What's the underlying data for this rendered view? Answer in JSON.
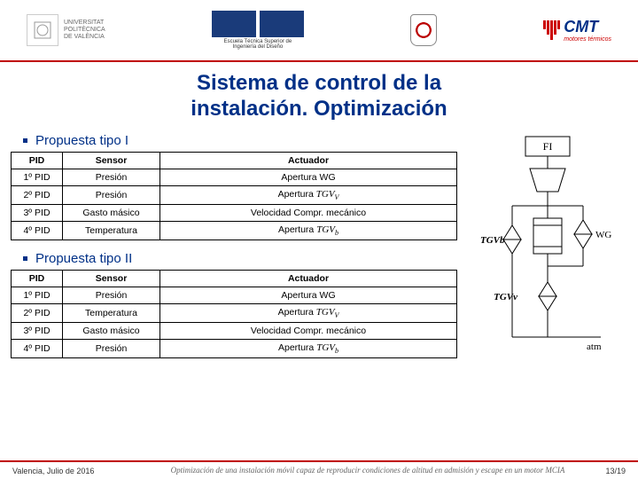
{
  "header": {
    "upv_line1": "UNIVERSITAT",
    "upv_line2": "POLITÈCNICA",
    "upv_line3": "DE VALÈNCIA",
    "etsid": "Escuela Técnica Superior de Ingeniería del Diseño",
    "cmt": "CMT",
    "cmt_sub": "motores térmicos"
  },
  "title_line1": "Sistema de control de la",
  "title_line2": "instalación. Optimización",
  "section1": "Propuesta tipo I",
  "section2": "Propuesta tipo II",
  "cols": {
    "c1": "PID",
    "c2": "Sensor",
    "c3": "Actuador"
  },
  "t1": [
    {
      "pid": "1º PID",
      "sensor": "Presión",
      "act": "Apertura WG",
      "math": false
    },
    {
      "pid": "2º PID",
      "sensor": "Presión",
      "act": "Apertura TGVV",
      "math": true
    },
    {
      "pid": "3º PID",
      "sensor": "Gasto másico",
      "act": "Velocidad Compr. mecánico",
      "math": false
    },
    {
      "pid": "4º PID",
      "sensor": "Temperatura",
      "act": "Apertura TGVb",
      "math": true
    }
  ],
  "t2": [
    {
      "pid": "1º PID",
      "sensor": "Presión",
      "act": "Apertura WG",
      "math": false
    },
    {
      "pid": "2º PID",
      "sensor": "Temperatura",
      "act": "Apertura TGVV",
      "math": true
    },
    {
      "pid": "3º PID",
      "sensor": "Gasto másico",
      "act": "Velocidad Compr. mecánico",
      "math": false
    },
    {
      "pid": "4º PID",
      "sensor": "Presión",
      "act": "Apertura TGVb",
      "math": true
    }
  ],
  "diagram": {
    "fi": "FI",
    "tgvb": "TGVb",
    "tgvv": "TGVv",
    "wg": "WG",
    "atm": "atm"
  },
  "footer": {
    "left": "Valencia, Julio de 2016",
    "center": "Optimización de una instalación móvil capaz de reproducir condiciones de altitud en admisión y escape en un motor MCIA",
    "right": "13/19"
  }
}
